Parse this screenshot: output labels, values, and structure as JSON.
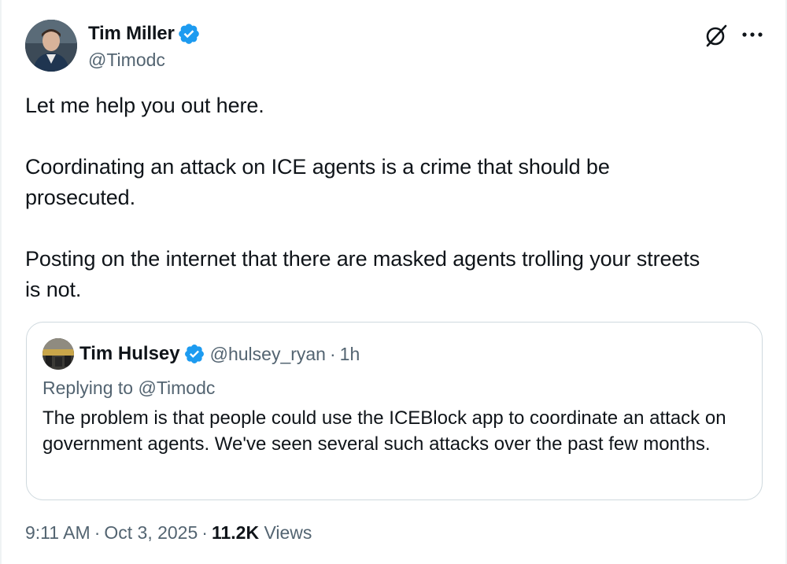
{
  "author": {
    "display_name": "Tim Miller",
    "handle": "@Timodc",
    "verified": true
  },
  "header_icons": [
    "grok-icon",
    "more-icon"
  ],
  "tweet": {
    "paragraphs": [
      "Let me help you out here.",
      "Coordinating an attack on ICE agents is a crime that should be\nprosecuted.",
      "Posting on the internet that there are masked agents trolling your streets\nis not."
    ]
  },
  "quote": {
    "display_name": "Tim Hulsey",
    "handle": "@hulsey_ryan",
    "separator": "·",
    "time": "1h",
    "verified": true,
    "replying_prefix": "Replying to ",
    "replying_to": "@Timodc",
    "text": "The problem is that people could use the ICEBlock app to coordinate an attack on government agents. We've seen several such attacks over the past few months."
  },
  "meta": {
    "time": "9:11 AM",
    "separator": "·",
    "date": "Oct 3, 2025",
    "views_count": "11.2K",
    "views_label": "Views"
  },
  "colors": {
    "verified_blue": "#1d9bf0",
    "text_primary": "#0f1419",
    "text_secondary": "#536471",
    "border": "#cfd9de"
  }
}
